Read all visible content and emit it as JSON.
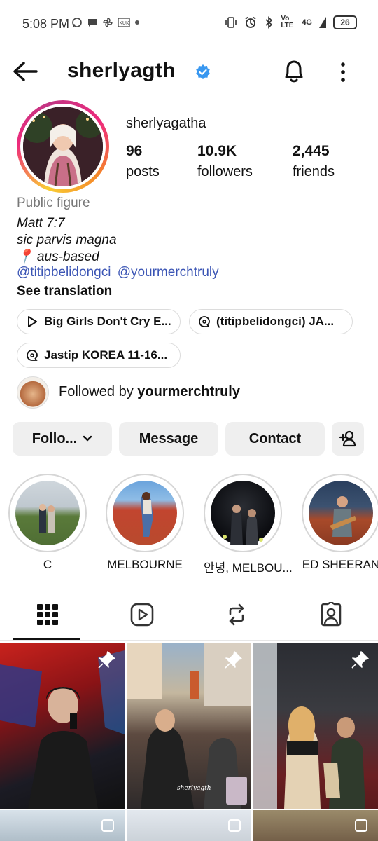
{
  "status_bar": {
    "time": "5:08 PM",
    "battery": "26",
    "network": "4G",
    "volte": "Vo LTE"
  },
  "header": {
    "username": "sherlyagth",
    "verified_color": "#3897f0"
  },
  "profile": {
    "display_name": "sherlyagatha",
    "stats": [
      {
        "value": "96",
        "label": "posts"
      },
      {
        "value": "10.9K",
        "label": "followers"
      },
      {
        "value": "2,445",
        "label": "friends"
      }
    ],
    "category": "Public figure",
    "bio_lines": [
      "Matt 7:7",
      "sic parvis magna",
      "📍 aus-based"
    ],
    "threads_links": [
      "@titipbelidongci",
      "@yourmerchtruly"
    ],
    "see_translation": "See translation"
  },
  "chips": [
    {
      "icon": "play-circle-icon",
      "label": "Big Girls Don't Cry E..."
    },
    {
      "icon": "threads-chat-icon",
      "label": "(titipbelidongci) JA..."
    },
    {
      "icon": "threads-chat-icon",
      "label": "Jastip KOREA 11-16..."
    }
  ],
  "followed_by": {
    "prefix": "Followed by",
    "name": "yourmerchtruly"
  },
  "actions": {
    "follow": "Follo...",
    "message": "Message",
    "contact": "Contact"
  },
  "highlights": [
    {
      "label": "C"
    },
    {
      "label": "MELBOURNE"
    },
    {
      "label": "안녕, MELBOU..."
    },
    {
      "label": "ED SHEERAN"
    }
  ],
  "tabs": [
    {
      "icon": "grid-icon",
      "active": true
    },
    {
      "icon": "reels-icon",
      "active": false
    },
    {
      "icon": "reposts-icon",
      "active": false
    },
    {
      "icon": "tagged-icon",
      "active": false
    }
  ],
  "posts": [
    {
      "pinned": true
    },
    {
      "pinned": true,
      "watermark": "sherlyagth"
    },
    {
      "pinned": true
    }
  ]
}
